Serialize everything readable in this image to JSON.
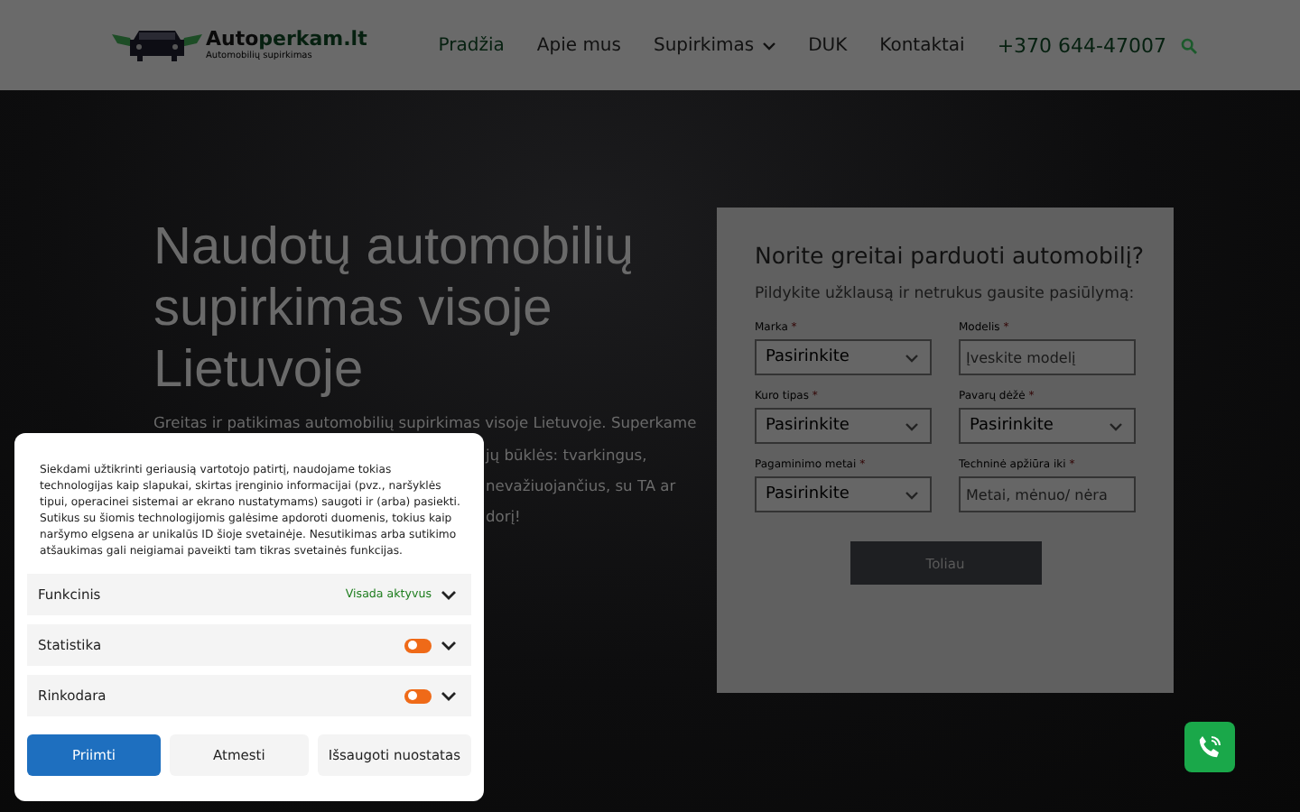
{
  "header": {
    "logo": {
      "text_dark": "Auto",
      "text_green": "perkam.lt",
      "tagline": "Automobilių supirkimas"
    },
    "nav": [
      {
        "label": "Pradžia",
        "selected": true,
        "dropdown": false
      },
      {
        "label": "Apie mus",
        "selected": false,
        "dropdown": false
      },
      {
        "label": "Supirkimas",
        "selected": false,
        "dropdown": true
      },
      {
        "label": "DUK",
        "selected": false,
        "dropdown": false
      },
      {
        "label": "Kontaktai",
        "selected": false,
        "dropdown": false
      }
    ],
    "phone": "+370 644-47007"
  },
  "hero": {
    "title": "Naudotų automobilių supirkimas visoje Lietuvoje",
    "paragraph_lines": [
      "Greitas ir patikimas automobilių supirkimas visoje Lietuvoje. Superkame",
      "jų būklės: tvarkingus,",
      "nevažiuojančius, su TA ar",
      "dorį!"
    ]
  },
  "form": {
    "title": "Norite greitai parduoti automobilį?",
    "subtitle": "Pildykite užklausą ir netrukus gausite pasiūlymą:",
    "fields": [
      {
        "label": "Marka",
        "required_mark": "*",
        "kind": "select",
        "value": "Pasirinkite"
      },
      {
        "label": "Modelis",
        "required_mark": "*",
        "kind": "text",
        "placeholder": "Įveskite modelį"
      },
      {
        "label": "Kuro tipas",
        "required_mark": "*",
        "kind": "select",
        "value": "Pasirinkite"
      },
      {
        "label": "Pavarų dėžė",
        "required_mark": "*",
        "kind": "select",
        "value": "Pasirinkite"
      },
      {
        "label": "Pagaminimo metai",
        "required_mark": "*",
        "kind": "select",
        "value": "Pasirinkite"
      },
      {
        "label": "Techninė apžiūra iki",
        "required_mark": "*",
        "kind": "text",
        "placeholder": "Metai, mėnuo/ nėra"
      }
    ],
    "submit": "Toliau"
  },
  "cookie_banner": {
    "text": "Siekdami užtikrinti geriausią vartotojo patirtį, naudojame tokias technologijas kaip slapukai, skirtas įrenginio informacijai (pvz., naršyklės tipui, operacinei sistemai ar ekrano nustatymams) saugoti ir (arba) pasiekti. Sutikus su šiomis technologijomis galėsime apdoroti duomenis, tokius kaip naršymo elgsena ar unikalūs ID šioje svetainėje. Nesutikimas arba sutikimo atšaukimas gali neigiamai paveikti tam tikras svetainės funkcijas.",
    "categories": [
      {
        "name": "Funkcinis",
        "kind": "always",
        "status": "Visada aktyvus"
      },
      {
        "name": "Statistika",
        "kind": "toggle",
        "on": false
      },
      {
        "name": "Rinkodara",
        "kind": "toggle",
        "on": false
      }
    ],
    "buttons": [
      {
        "label": "Priimti",
        "kind": "primary"
      },
      {
        "label": "Atmesti",
        "kind": "secondary"
      },
      {
        "label": "Išsaugoti nuostatas",
        "kind": "secondary"
      }
    ]
  }
}
